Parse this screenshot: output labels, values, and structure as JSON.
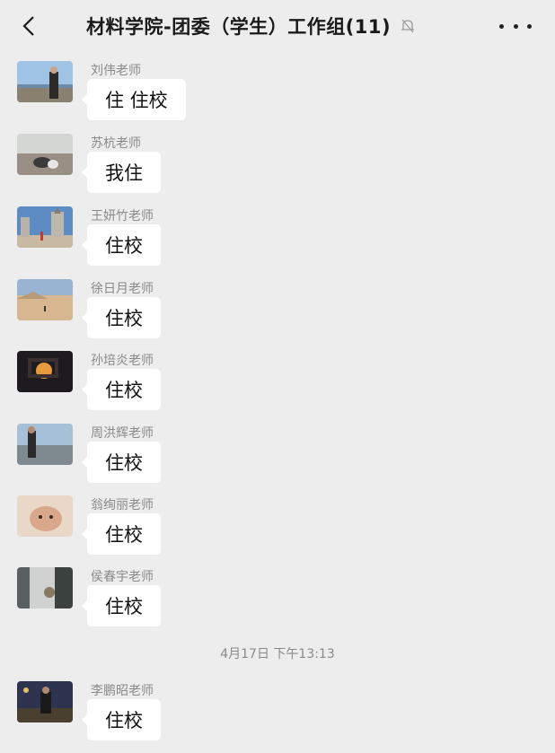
{
  "header": {
    "title": "材料学院-团委（学生）工作组(11)",
    "back_icon": "chevron-left-icon",
    "mute_icon": "bell-off-icon",
    "more_icon": "more-horizontal-icon"
  },
  "messages": [
    {
      "sender": "刘伟老师",
      "text": "住 住校"
    },
    {
      "sender": "苏杭老师",
      "text": "我住"
    },
    {
      "sender": "王妍竹老师",
      "text": "住校"
    },
    {
      "sender": "徐日月老师",
      "text": "住校"
    },
    {
      "sender": "孙培炎老师",
      "text": "住校"
    },
    {
      "sender": "周洪辉老师",
      "text": "住校"
    },
    {
      "sender": "翁绚丽老师",
      "text": "住校"
    },
    {
      "sender": "侯春宇老师",
      "text": "住校"
    }
  ],
  "timestamp": "4月17日  下午13:13",
  "after": [
    {
      "sender": "李鹏昭老师",
      "text": "住校"
    }
  ]
}
